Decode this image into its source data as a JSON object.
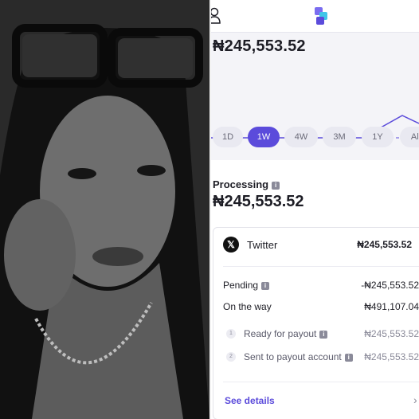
{
  "balance": {
    "amount": "₦245,553.52"
  },
  "ranges": [
    "1D",
    "1W",
    "4W",
    "3M",
    "1Y",
    "All"
  ],
  "active_range": "1W",
  "processing": {
    "label": "Processing",
    "amount": "₦245,553.52"
  },
  "source": {
    "name": "Twitter",
    "amount": "₦245,553.52"
  },
  "lines": [
    {
      "label": "Pending",
      "value": "-₦245,553.52"
    },
    {
      "label": "On the way",
      "value": "₦491,107.04"
    }
  ],
  "steps": [
    {
      "num": "1",
      "label": "Ready for payout",
      "value": "₦245,553.52"
    },
    {
      "num": "2",
      "label": "Sent to payout account",
      "value": "₦245,553.52"
    }
  ],
  "see_details": "See details",
  "colors": {
    "accent": "#5b4bdb",
    "text": "#1d1d25",
    "muted": "#8a8a99",
    "panel": "#f4f4f8"
  }
}
